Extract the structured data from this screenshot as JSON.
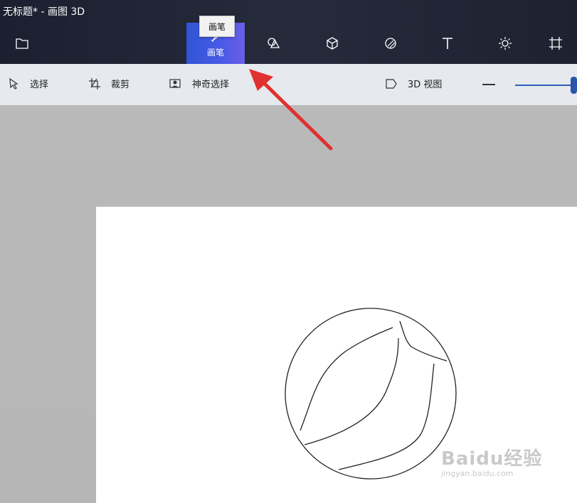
{
  "window": {
    "title": "无标题* - 画图 3D"
  },
  "toolbar": {
    "tooltip": "画笔",
    "tools": [
      {
        "id": "menu",
        "icon": "folder-icon",
        "label": ""
      },
      {
        "id": "brushes",
        "icon": "brush-icon",
        "label": "画笔",
        "active": true
      },
      {
        "id": "shapes2d",
        "icon": "2d-shapes-icon",
        "label": ""
      },
      {
        "id": "shapes3d",
        "icon": "3d-shapes-icon",
        "label": ""
      },
      {
        "id": "stickers",
        "icon": "stickers-icon",
        "label": ""
      },
      {
        "id": "text",
        "icon": "text-icon",
        "label": ""
      },
      {
        "id": "effects",
        "icon": "effects-icon",
        "label": ""
      },
      {
        "id": "canvas",
        "icon": "canvas-icon",
        "label": ""
      }
    ],
    "active_color": "#4a5ae6"
  },
  "subbar": {
    "select": "选择",
    "crop": "裁剪",
    "magic_select": "神奇选择",
    "view3d": "3D 视图"
  },
  "zoom": {
    "level": 1.0
  },
  "annotation": {
    "arrow_color": "#e03030"
  },
  "watermark": {
    "logo": "Baidu经验",
    "url": "jingyan.baidu.com"
  }
}
